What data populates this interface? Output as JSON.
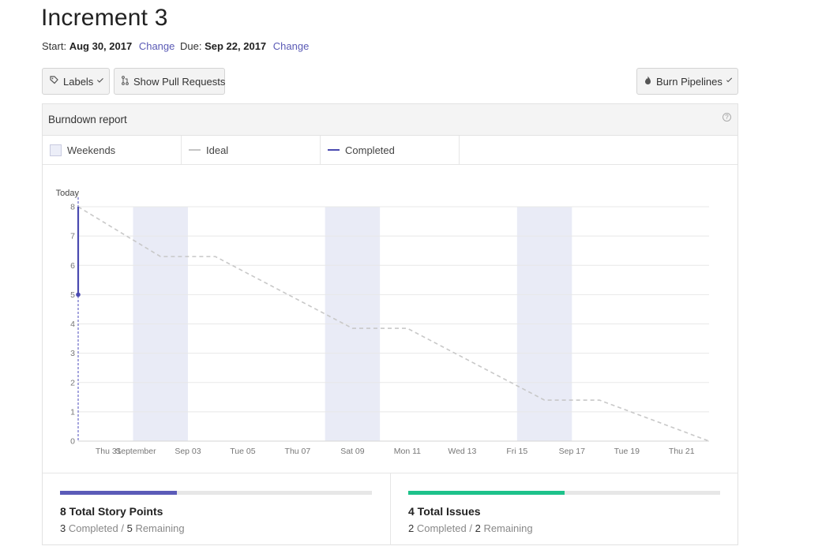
{
  "header": {
    "title": "Increment 3",
    "start_label": "Start:",
    "start_date": "Aug 30, 2017",
    "start_change": "Change",
    "due_label": "Due:",
    "due_date": "Sep 22, 2017",
    "due_change": "Change"
  },
  "toolbar": {
    "labels_button": "Labels",
    "labels_icon": "tag-icon",
    "pull_requests_button": "Show Pull Requests",
    "pull_requests_icon": "pull-request-icon",
    "burn_button": "Burn Pipelines",
    "burn_icon": "flame-icon"
  },
  "panel": {
    "title": "Burndown report",
    "help_icon": "question-circle-icon"
  },
  "legend": {
    "weekends": "Weekends",
    "ideal": "Ideal",
    "completed": "Completed"
  },
  "chart_data": {
    "type": "line",
    "annotation": "Today",
    "y_ticks": [
      0,
      1,
      2,
      3,
      4,
      5,
      6,
      7,
      8
    ],
    "ylim": [
      0,
      8
    ],
    "x_ticks": [
      "Thu 31",
      "September",
      "Sep 03",
      "Tue 05",
      "Thu 07",
      "Sat 09",
      "Mon 11",
      "Wed 13",
      "Fri 15",
      "Sep 17",
      "Tue 19",
      "Thu 21"
    ],
    "x_range_days": [
      0,
      23
    ],
    "weekend_day_ranges": [
      [
        2,
        4
      ],
      [
        9,
        11
      ],
      [
        16,
        18
      ]
    ],
    "series": [
      {
        "name": "Ideal",
        "style": "dashed",
        "color": "#c8c8c8",
        "days": [
          0,
          3,
          5,
          10,
          12,
          17,
          19,
          23
        ],
        "values": [
          8,
          6.3,
          6.3,
          3.85,
          3.85,
          1.4,
          1.4,
          0
        ]
      },
      {
        "name": "Completed",
        "color": "#4a4ab0",
        "days": [
          0,
          0
        ],
        "values": [
          8,
          5
        ]
      }
    ],
    "colors": {
      "weekend": "#e9ebf6",
      "grid": "#e8e8e8",
      "today": "#6a6ac8"
    }
  },
  "stats": {
    "story_points": {
      "title": "8 Total Story Points",
      "completed": "3",
      "completed_label": "Completed /",
      "remaining": "5",
      "remaining_label": "Remaining",
      "progress": 0.375,
      "color": "#5b5bb8"
    },
    "issues": {
      "title": "4 Total Issues",
      "completed": "2",
      "completed_label": "Completed /",
      "remaining": "2",
      "remaining_label": "Remaining",
      "progress": 0.5,
      "color": "#1ec28b"
    }
  }
}
